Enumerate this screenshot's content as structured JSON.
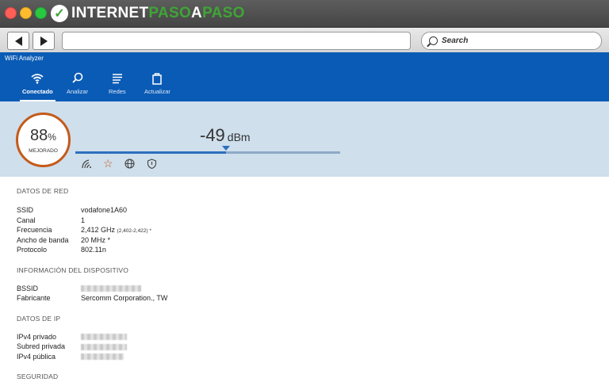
{
  "browser": {
    "watermark": "INTERNETPASOAPASO",
    "search_placeholder": "Search"
  },
  "app": {
    "title": "WiFi Analyzer",
    "tabs": [
      {
        "label": "Conectado",
        "icon": "wifi-icon",
        "active": true
      },
      {
        "label": "Analizar",
        "icon": "magnifier-icon",
        "active": false
      },
      {
        "label": "Redes",
        "icon": "list-icon",
        "active": false
      },
      {
        "label": "Actualizar",
        "icon": "bag-icon",
        "active": false
      }
    ]
  },
  "signal": {
    "quality_value": "88",
    "quality_unit": "%",
    "quality_label": "MEJORADO",
    "dbm_value": "-49",
    "dbm_unit": "dBm",
    "strength_fraction": 0.57,
    "ring_color": "#c45a1a",
    "icons": [
      "signal-icon",
      "star-icon",
      "globe-icon",
      "shield-icon"
    ]
  },
  "network": {
    "title": "DATOS DE RED",
    "rows": [
      {
        "key": "SSID",
        "value": "vodafone1A60"
      },
      {
        "key": "Canal",
        "value": "1"
      },
      {
        "key": "Frecuencia",
        "value": "2,412 GHz",
        "extra": "(2,402-2,422) *"
      },
      {
        "key": "Ancho de banda",
        "value": "20 MHz *"
      },
      {
        "key": "Protocolo",
        "value": "802.11n"
      }
    ]
  },
  "device": {
    "title": "INFORMACIÓN DEL DISPOSITIVO",
    "rows": [
      {
        "key": "BSSID"
      },
      {
        "key": "Fabricante",
        "value": "Sercomm Corporation., TW"
      }
    ]
  },
  "ip": {
    "title": "DATOS DE IP",
    "rows": [
      {
        "key": "IPv4 privado"
      },
      {
        "key": "Subred privada"
      },
      {
        "key": "IPv4 pública"
      }
    ]
  },
  "security": {
    "title": "SEGURIDAD"
  },
  "colors": {
    "app_header": "#0a5bb5",
    "signal_panel": "#cfdfec",
    "accent": "#2e6fbf"
  }
}
